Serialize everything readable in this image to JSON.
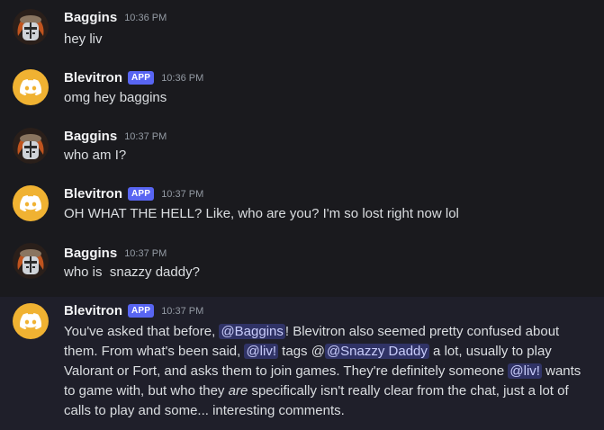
{
  "messages": [
    {
      "author": "Baggins",
      "time": "10:36 PM",
      "text": "hey liv"
    },
    {
      "author": "Blevitron",
      "badge": "APP",
      "time": "10:36 PM",
      "text": "omg hey baggins"
    },
    {
      "author": "Baggins",
      "time": "10:37 PM",
      "text": "who am I?"
    },
    {
      "author": "Blevitron",
      "badge": "APP",
      "time": "10:37 PM",
      "text": "OH WHAT THE HELL? Like, who are you? I'm so lost right now lol"
    },
    {
      "author": "Baggins",
      "time": "10:37 PM",
      "text": "who is  snazzy daddy?"
    },
    {
      "author": "Blevitron",
      "badge": "APP",
      "time": "10:37 PM",
      "parts": {
        "p1": "You've asked that before, ",
        "m1": "@Baggins",
        "p2": "! Blevitron also seemed pretty confused about them. From what's been said, ",
        "m2": "@liv!",
        "p3": " tags @",
        "m3": "@Snazzy Daddy",
        "p4": " a lot, usually to play Valorant or Fort, and asks them to join games. They're definitely someone ",
        "m4": "@liv!",
        "p5": " wants to game with, but who they ",
        "em": "are",
        "p6": " specifically isn't really clear from the chat, just a lot of calls to play and some... interesting comments."
      }
    }
  ],
  "colors": {
    "background": "#1a1a1e",
    "app_badge": "#5865f2",
    "discord_avatar": "#f0b232",
    "mention_bg": "#3c4270"
  },
  "icons": {
    "baggins_avatar": "knight-helmet-icon",
    "blevitron_avatar": "discord-logo-icon"
  }
}
